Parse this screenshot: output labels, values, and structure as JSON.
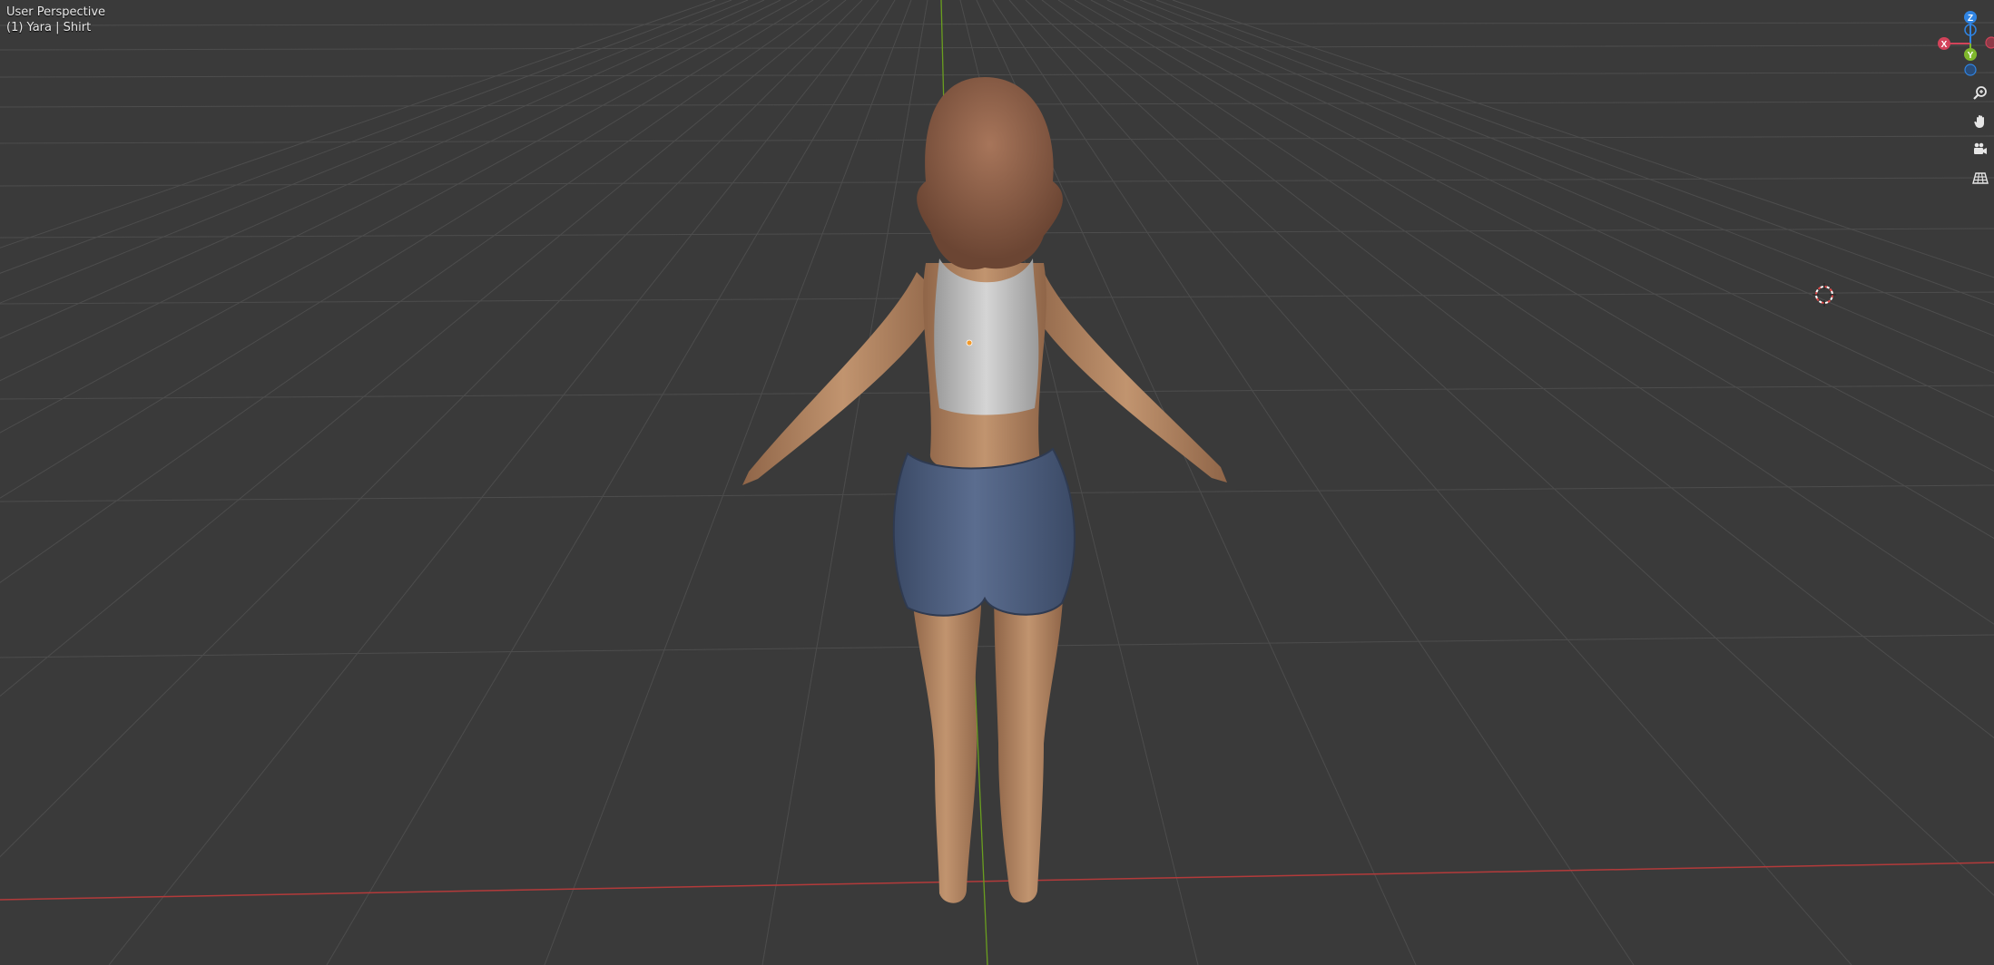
{
  "viewport": {
    "view_name": "User Perspective",
    "object_info": "(1) Yara | Shirt"
  },
  "gizmo": {
    "axis_z_label": "Z",
    "axis_y_label": "Y",
    "axis_x_label": "X",
    "colors": {
      "x": "#d2435a",
      "y": "#7fb82c",
      "z": "#2f84e3"
    }
  },
  "navigation_buttons": [
    {
      "name": "zoom-icon"
    },
    {
      "name": "pan-hand-icon"
    },
    {
      "name": "camera-view-icon"
    },
    {
      "name": "perspective-toggle-icon"
    }
  ],
  "colors": {
    "background": "#3a3a3a",
    "grid": "#4d4d4d",
    "x_axis_line": "#b33a3a",
    "y_axis_line": "#6a9e1f"
  }
}
